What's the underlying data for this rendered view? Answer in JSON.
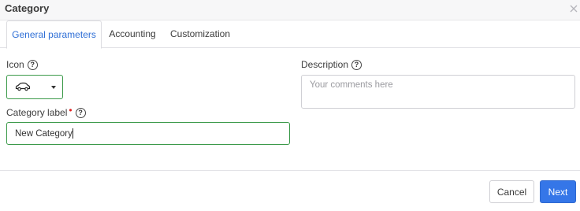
{
  "dialog": {
    "title": "Category"
  },
  "tabs": [
    {
      "label": "General parameters",
      "active": true
    },
    {
      "label": "Accounting",
      "active": false
    },
    {
      "label": "Customization",
      "active": false
    }
  ],
  "form": {
    "icon_label": "Icon",
    "icon_value": "car-icon",
    "category_label": "Category label",
    "required_mark": "•",
    "category_value": "New Category",
    "description_label": "Description",
    "description_placeholder": "Your comments here",
    "help_glyph": "?"
  },
  "footer": {
    "cancel_label": "Cancel",
    "next_label": "Next"
  },
  "colors": {
    "accent": "#3576e8",
    "active_tab_text": "#2f6fd6",
    "focus_border": "#3c9a4a",
    "required": "#e02020"
  }
}
